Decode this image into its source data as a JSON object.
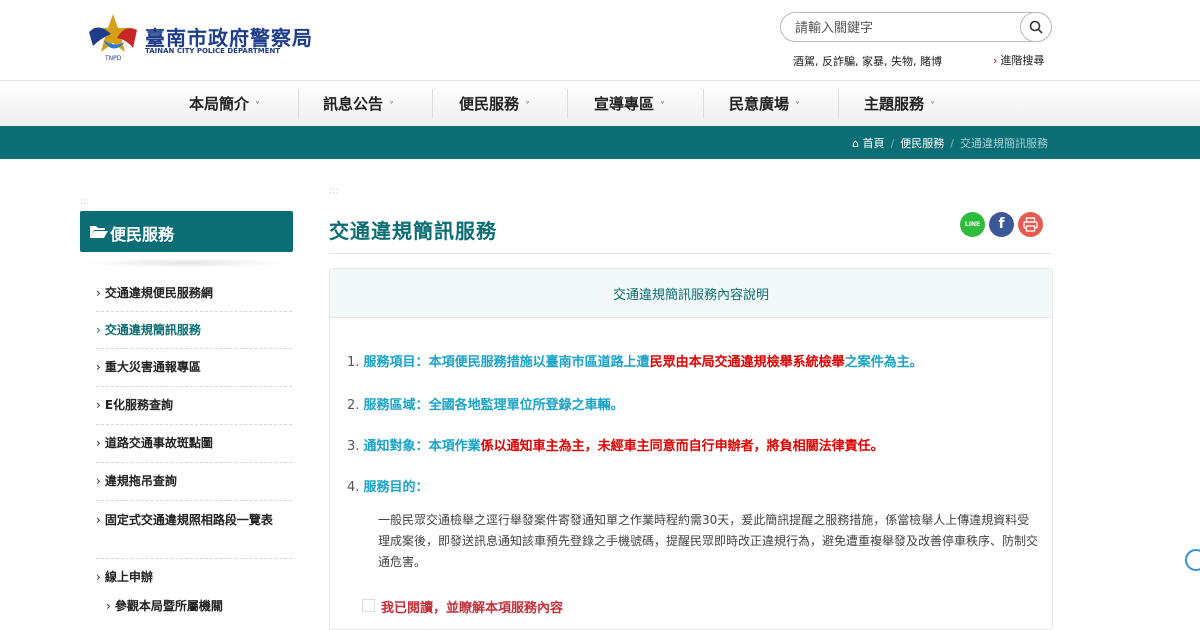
{
  "header": {
    "logo_zh": "臺南市政府警察局",
    "logo_en": "TAINAN CITY POLICE DEPARTMENT",
    "logo_small": "TNPD",
    "search_placeholder": "請輸入關鍵字",
    "search_icon": "search-icon",
    "hot_keywords": "酒駕, 反詐騙, 家暴, 失物, 賭博",
    "advanced_search": "進階搜尋"
  },
  "nav": {
    "items": [
      {
        "label": "本局簡介"
      },
      {
        "label": "訊息公告"
      },
      {
        "label": "便民服務"
      },
      {
        "label": "宣導專區"
      },
      {
        "label": "民意廣場"
      },
      {
        "label": "主題服務"
      }
    ]
  },
  "breadcrumb": {
    "home": "首頁",
    "level1": "便民服務",
    "current": "交通違規簡訊服務"
  },
  "sidebar": {
    "title": "便民服務",
    "items": [
      {
        "label": "交通違規便民服務網"
      },
      {
        "label": "交通違規簡訊服務"
      },
      {
        "label": "重大災害通報專區"
      },
      {
        "label": "E化服務查詢"
      },
      {
        "label": "道路交通事故斑點圖"
      },
      {
        "label": "違規拖吊查詢"
      },
      {
        "label": "固定式交通違規照相路段一覽表"
      },
      {
        "label": "線上申辦"
      },
      {
        "label": "參觀本局暨所屬機關"
      }
    ]
  },
  "main": {
    "title": "交通違規簡訊服務",
    "share": {
      "line": "LINE",
      "facebook": "f",
      "print": "print-icon"
    },
    "box_title": "交通違規簡訊服務內容說明",
    "items": [
      {
        "num": "1.",
        "label": "服務項目：",
        "text1": "本項便民服務措施以臺南市區道路上遭",
        "text2": "民眾由本局交通違規檢舉系統檢舉",
        "text3": "之案件為主。"
      },
      {
        "num": "2.",
        "label": "服務區域：",
        "text1": "全國各地監理單位所登錄之車輛。"
      },
      {
        "num": "3.",
        "label": "通知對象：",
        "text1": "本項作業",
        "text2": "係以通知車主為主，未經車主同意而自行申辦者，將負相關法律責任。"
      },
      {
        "num": "4.",
        "label": "服務目的："
      }
    ],
    "paragraph": "一般民眾交通檢舉之逕行舉發案件寄發通知單之作業時程約需30天，爰此簡訊提醒之服務措施，係當檢舉人上傳違規資料受理成案後，即發送訊息通知該車預先登錄之手機號碼，提醒民眾即時改正違規行為，避免遭重複舉發及改善停車秩序、防制交通危害。",
    "agree": "我已閱讀，並瞭解本項服務內容"
  },
  "colors": {
    "teal": "#0a6e74",
    "blue": "#1aa3c9",
    "red": "#e00000"
  }
}
